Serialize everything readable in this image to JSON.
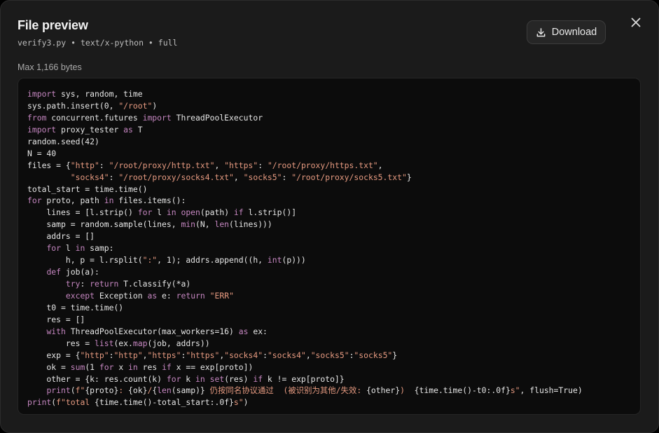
{
  "header": {
    "title": "File preview",
    "subtitle": "verify3.py • text/x-python • full",
    "max_bytes": "Max 1,166 bytes"
  },
  "toolbar": {
    "download_label": "Download"
  },
  "icons": {
    "download": "download-icon",
    "close": "close-icon"
  },
  "colors": {
    "modal_bg": "#1b1b1b",
    "code_bg": "#0c0c0c",
    "keyword": "#c586c0",
    "string": "#e69a80",
    "text": "#e6e6e6"
  },
  "code": {
    "language": "python",
    "lines": [
      [
        [
          "kw",
          "import"
        ],
        [
          "p",
          " sys, random, time"
        ]
      ],
      [
        [
          "p",
          "sys.path.insert(0, "
        ],
        [
          "s",
          "\"/root\""
        ],
        [
          "p",
          ")"
        ]
      ],
      [
        [
          "kw",
          "from"
        ],
        [
          "p",
          " concurrent.futures "
        ],
        [
          "kw",
          "import"
        ],
        [
          "p",
          " ThreadPoolExecutor"
        ]
      ],
      [
        [
          "kw",
          "import"
        ],
        [
          "p",
          " proxy_tester "
        ],
        [
          "kw",
          "as"
        ],
        [
          "p",
          " T"
        ]
      ],
      [
        [
          "p",
          "random.seed(42)"
        ]
      ],
      [
        [
          "p",
          "N = 40"
        ]
      ],
      [
        [
          "p",
          "files = {"
        ],
        [
          "s",
          "\"http\""
        ],
        [
          "p",
          ": "
        ],
        [
          "s",
          "\"/root/proxy/http.txt\""
        ],
        [
          "p",
          ", "
        ],
        [
          "s",
          "\"https\""
        ],
        [
          "p",
          ": "
        ],
        [
          "s",
          "\"/root/proxy/https.txt\""
        ],
        [
          "p",
          ","
        ]
      ],
      [
        [
          "p",
          "         "
        ],
        [
          "s",
          "\"socks4\""
        ],
        [
          "p",
          ": "
        ],
        [
          "s",
          "\"/root/proxy/socks4.txt\""
        ],
        [
          "p",
          ", "
        ],
        [
          "s",
          "\"socks5\""
        ],
        [
          "p",
          ": "
        ],
        [
          "s",
          "\"/root/proxy/socks5.txt\""
        ],
        [
          "p",
          "}"
        ]
      ],
      [
        [
          "p",
          "total_start = time.time()"
        ]
      ],
      [
        [
          "kw",
          "for"
        ],
        [
          "p",
          " proto, path "
        ],
        [
          "kw",
          "in"
        ],
        [
          "p",
          " files.items():"
        ]
      ],
      [
        [
          "p",
          "    lines = [l.strip() "
        ],
        [
          "kw",
          "for"
        ],
        [
          "p",
          " l "
        ],
        [
          "kw",
          "in"
        ],
        [
          "p",
          " "
        ],
        [
          "kw",
          "open"
        ],
        [
          "p",
          "(path) "
        ],
        [
          "kw",
          "if"
        ],
        [
          "p",
          " l.strip()]"
        ]
      ],
      [
        [
          "p",
          "    samp = random.sample(lines, "
        ],
        [
          "kw",
          "min"
        ],
        [
          "p",
          "(N, "
        ],
        [
          "kw",
          "len"
        ],
        [
          "p",
          "(lines)))"
        ]
      ],
      [
        [
          "p",
          "    addrs = []"
        ]
      ],
      [
        [
          "p",
          "    "
        ],
        [
          "kw",
          "for"
        ],
        [
          "p",
          " l "
        ],
        [
          "kw",
          "in"
        ],
        [
          "p",
          " samp:"
        ]
      ],
      [
        [
          "p",
          "        h, p = l.rsplit("
        ],
        [
          "s",
          "\":\""
        ],
        [
          "p",
          ", 1); addrs.append((h, "
        ],
        [
          "kw",
          "int"
        ],
        [
          "p",
          "(p)))"
        ]
      ],
      [
        [
          "p",
          "    "
        ],
        [
          "kw",
          "def"
        ],
        [
          "p",
          " job(a):"
        ]
      ],
      [
        [
          "p",
          "        "
        ],
        [
          "kw",
          "try"
        ],
        [
          "p",
          ": "
        ],
        [
          "kw",
          "return"
        ],
        [
          "p",
          " T.classify(*a)"
        ]
      ],
      [
        [
          "p",
          "        "
        ],
        [
          "kw",
          "except"
        ],
        [
          "p",
          " Exception "
        ],
        [
          "kw",
          "as"
        ],
        [
          "p",
          " e: "
        ],
        [
          "kw",
          "return"
        ],
        [
          "p",
          " "
        ],
        [
          "s",
          "\"ERR\""
        ]
      ],
      [
        [
          "p",
          "    t0 = time.time()"
        ]
      ],
      [
        [
          "p",
          "    res = []"
        ]
      ],
      [
        [
          "p",
          "    "
        ],
        [
          "kw",
          "with"
        ],
        [
          "p",
          " ThreadPoolExecutor(max_workers=16) "
        ],
        [
          "kw",
          "as"
        ],
        [
          "p",
          " ex:"
        ]
      ],
      [
        [
          "p",
          "        res = "
        ],
        [
          "kw",
          "list"
        ],
        [
          "p",
          "(ex."
        ],
        [
          "kw",
          "map"
        ],
        [
          "p",
          "(job, addrs))"
        ]
      ],
      [
        [
          "p",
          "    exp = {"
        ],
        [
          "s",
          "\"http\""
        ],
        [
          "p",
          ":"
        ],
        [
          "s",
          "\"http\""
        ],
        [
          "p",
          ","
        ],
        [
          "s",
          "\"https\""
        ],
        [
          "p",
          ":"
        ],
        [
          "s",
          "\"https\""
        ],
        [
          "p",
          ","
        ],
        [
          "s",
          "\"socks4\""
        ],
        [
          "p",
          ":"
        ],
        [
          "s",
          "\"socks4\""
        ],
        [
          "p",
          ","
        ],
        [
          "s",
          "\"socks5\""
        ],
        [
          "p",
          ":"
        ],
        [
          "s",
          "\"socks5\""
        ],
        [
          "p",
          "}"
        ]
      ],
      [
        [
          "p",
          "    ok = "
        ],
        [
          "kw",
          "sum"
        ],
        [
          "p",
          "(1 "
        ],
        [
          "kw",
          "for"
        ],
        [
          "p",
          " x "
        ],
        [
          "kw",
          "in"
        ],
        [
          "p",
          " res "
        ],
        [
          "kw",
          "if"
        ],
        [
          "p",
          " x == exp[proto])"
        ]
      ],
      [
        [
          "p",
          "    other = {k: res.count(k) "
        ],
        [
          "kw",
          "for"
        ],
        [
          "p",
          " k "
        ],
        [
          "kw",
          "in"
        ],
        [
          "p",
          " "
        ],
        [
          "kw",
          "set"
        ],
        [
          "p",
          "(res) "
        ],
        [
          "kw",
          "if"
        ],
        [
          "p",
          " k != exp[proto]}"
        ]
      ],
      [
        [
          "p",
          "    "
        ],
        [
          "kw",
          "print"
        ],
        [
          "p",
          "("
        ],
        [
          "s",
          "f\""
        ],
        [
          "p",
          "{proto}"
        ],
        [
          "s",
          ": "
        ],
        [
          "p",
          "{ok}"
        ],
        [
          "s",
          "/"
        ],
        [
          "p",
          "{"
        ],
        [
          "kw",
          "len"
        ],
        [
          "p",
          "(samp)}"
        ],
        [
          "s",
          " 仍按同名协议通过  (被识别为其他/失效: "
        ],
        [
          "p",
          "{other}"
        ],
        [
          "s",
          ")  "
        ],
        [
          "p",
          "{time.time()-t0:.0f}"
        ],
        [
          "s",
          "s\""
        ],
        [
          "p",
          ", flush=True)"
        ]
      ],
      [
        [
          "kw",
          "print"
        ],
        [
          "p",
          "("
        ],
        [
          "s",
          "f\"total "
        ],
        [
          "p",
          "{time.time()-total_start:.0f}"
        ],
        [
          "s",
          "s\""
        ],
        [
          "p",
          ")"
        ]
      ]
    ]
  }
}
